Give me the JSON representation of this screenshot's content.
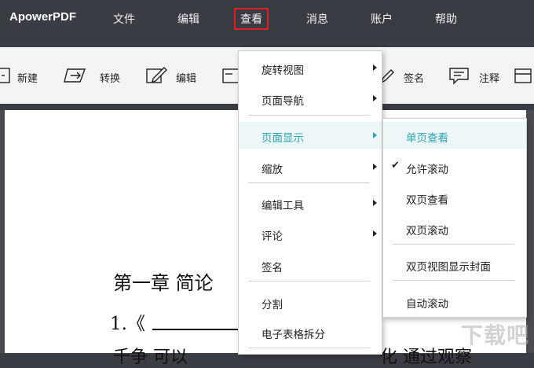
{
  "app": {
    "brand": "ApowerPDF"
  },
  "menubar": {
    "items": [
      "文件",
      "编辑",
      "查看",
      "消息",
      "账户",
      "帮助"
    ],
    "active": "查看"
  },
  "toolbar": {
    "items": [
      {
        "label": "新建",
        "icon": "new-file-icon"
      },
      {
        "label": "转换",
        "icon": "convert-icon"
      },
      {
        "label": "编辑",
        "icon": "edit-icon"
      },
      {
        "label": "签名",
        "icon": "pen-icon"
      },
      {
        "label": "注释",
        "icon": "comment-icon"
      }
    ]
  },
  "document": {
    "line1": "第一章  简论",
    "line2": "1.《",
    "line3": "千争  可以",
    "line3_right": "化  通过观察"
  },
  "view_menu": {
    "items": [
      {
        "label": "旋转视图",
        "submenu": true
      },
      {
        "label": "页面导航",
        "submenu": true
      },
      {
        "label": "页面显示",
        "submenu": true,
        "highlighted": true
      },
      {
        "label": "缩放",
        "submenu": true
      },
      {
        "label": "编辑工具",
        "submenu": true
      },
      {
        "label": "评论",
        "submenu": true
      },
      {
        "label": "签名",
        "submenu": false
      },
      {
        "label": "分割",
        "submenu": false
      },
      {
        "label": "电子表格拆分",
        "submenu": false
      }
    ]
  },
  "page_display_submenu": {
    "items": [
      {
        "label": "单页查看",
        "highlighted": true,
        "checked": false
      },
      {
        "label": "允许滚动",
        "highlighted": false,
        "checked": true
      },
      {
        "label": "双页查看",
        "highlighted": false,
        "checked": false
      },
      {
        "label": "双页滚动",
        "highlighted": false,
        "checked": false
      },
      {
        "label": "双页视图显示封面",
        "highlighted": false,
        "checked": false
      },
      {
        "label": "自动滚动",
        "highlighted": false,
        "checked": false
      }
    ]
  },
  "colors": {
    "menubar_bg": "#3a3c43",
    "highlight_text": "#2aa5b5",
    "highlight_bg": "#eef7f8",
    "active_outline": "#e02020"
  },
  "watermark": "下载吧"
}
